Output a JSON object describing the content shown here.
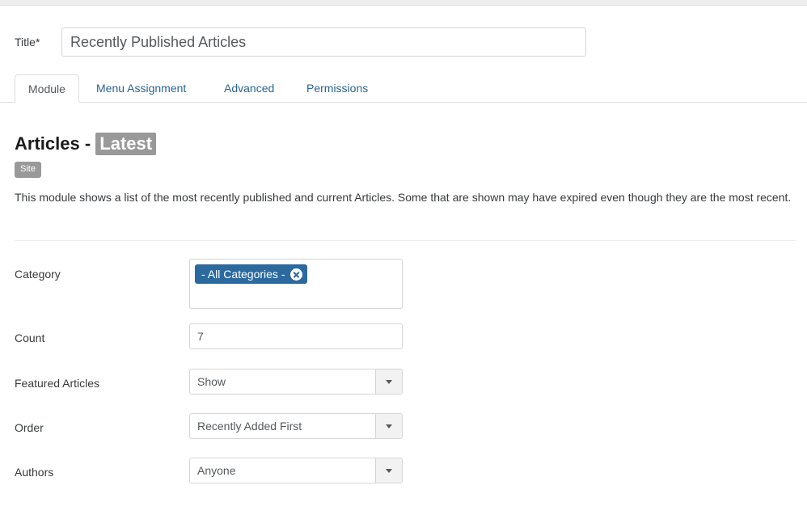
{
  "top_bar": {
    "present": true
  },
  "title_field": {
    "label": "Title",
    "required_mark": "*",
    "value": "Recently Published Articles",
    "placeholder": "Title"
  },
  "tabs": [
    {
      "label": "Module",
      "active": true
    },
    {
      "label": "Menu Assignment",
      "active": false
    },
    {
      "label": "Advanced",
      "active": false
    },
    {
      "label": "Permissions",
      "active": false
    }
  ],
  "module": {
    "heading_prefix": "Articles - ",
    "heading_badge": "Latest",
    "scope_badge": "Site",
    "description": "This module shows a list of the most recently published and current Articles. Some that are shown may have expired even though they are the most recent."
  },
  "fields": {
    "category": {
      "label": "Category",
      "chip_label": "- All Categories -",
      "remove_icon": "close-circle-icon"
    },
    "count": {
      "label": "Count",
      "value": "7",
      "placeholder": "Count"
    },
    "featured_articles": {
      "label": "Featured Articles",
      "value": "Show",
      "caret_icon": "chevron-down-icon"
    },
    "order": {
      "label": "Order",
      "value": "Recently Added First",
      "caret_icon": "chevron-down-icon"
    },
    "authors": {
      "label": "Authors",
      "value": "Anyone",
      "caret_icon": "chevron-down-icon"
    }
  },
  "colors": {
    "chip_blue": "#2b699f",
    "badge_gray": "#999999",
    "link_blue": "#2a6496",
    "border_gray": "#d6d6d6"
  }
}
